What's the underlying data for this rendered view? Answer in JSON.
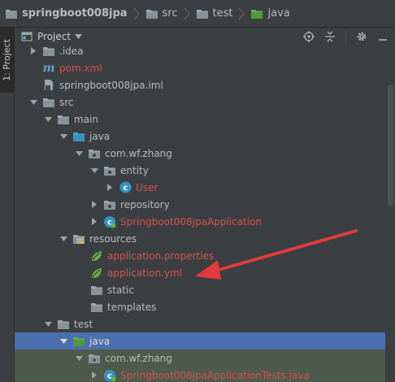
{
  "breadcrumb": {
    "items": [
      {
        "label": "springboot008jpa",
        "icon": "folder-icon"
      },
      {
        "label": "src",
        "icon": "folder-icon"
      },
      {
        "label": "test",
        "icon": "folder-icon"
      },
      {
        "label": "java",
        "icon": "test-source-folder-icon"
      }
    ]
  },
  "tool_strip": {
    "tab_label": "1: Project"
  },
  "panel": {
    "title": "Project",
    "icons": [
      "locate-icon",
      "collapse-all-icon",
      "settings-icon",
      "hide-icon"
    ]
  },
  "tree": {
    "rows": [
      {
        "label": ".idea",
        "arrow": "right",
        "icon": "folder",
        "color": "normal"
      },
      {
        "label": "pom.xml",
        "arrow": "none",
        "icon": "maven",
        "color": "red"
      },
      {
        "label": "springboot008jpa.iml",
        "arrow": "none",
        "icon": "iml-file",
        "color": "normal"
      },
      {
        "label": "src",
        "arrow": "down",
        "icon": "folder",
        "color": "normal"
      },
      {
        "label": "main",
        "arrow": "down",
        "icon": "folder",
        "color": "normal"
      },
      {
        "label": "java",
        "arrow": "down",
        "icon": "source-folder",
        "color": "normal"
      },
      {
        "label": "com.wf.zhang",
        "arrow": "down",
        "icon": "package",
        "color": "normal"
      },
      {
        "label": "entity",
        "arrow": "down",
        "icon": "package",
        "color": "normal"
      },
      {
        "label": "User",
        "arrow": "right",
        "icon": "class",
        "color": "red"
      },
      {
        "label": "repository",
        "arrow": "right",
        "icon": "package",
        "color": "normal"
      },
      {
        "label": "Springboot008jpaApplication",
        "arrow": "right",
        "icon": "spring-class",
        "color": "red"
      },
      {
        "label": "resources",
        "arrow": "down",
        "icon": "resources-folder",
        "color": "normal"
      },
      {
        "label": "application.properties",
        "arrow": "none",
        "icon": "spring-config",
        "color": "red"
      },
      {
        "label": "application.yml",
        "arrow": "none",
        "icon": "spring-config",
        "color": "red"
      },
      {
        "label": "static",
        "arrow": "none",
        "icon": "folder",
        "color": "normal"
      },
      {
        "label": "templates",
        "arrow": "none",
        "icon": "folder",
        "color": "normal"
      },
      {
        "label": "test",
        "arrow": "down",
        "icon": "folder",
        "color": "normal"
      },
      {
        "label": "java",
        "arrow": "down",
        "icon": "test-source-folder",
        "color": "selected"
      },
      {
        "label": "com.wf.zhang",
        "arrow": "down",
        "icon": "package",
        "color": "normal"
      },
      {
        "label": "Springboot008jpaApplicationTests.java",
        "arrow": "right",
        "icon": "spring-class",
        "color": "red"
      }
    ]
  },
  "colors": {
    "background": "#3c3f41",
    "selection": "#4b6eaf",
    "vcs_added": "#d25252",
    "annotation_arrow": "#e23b3b"
  }
}
